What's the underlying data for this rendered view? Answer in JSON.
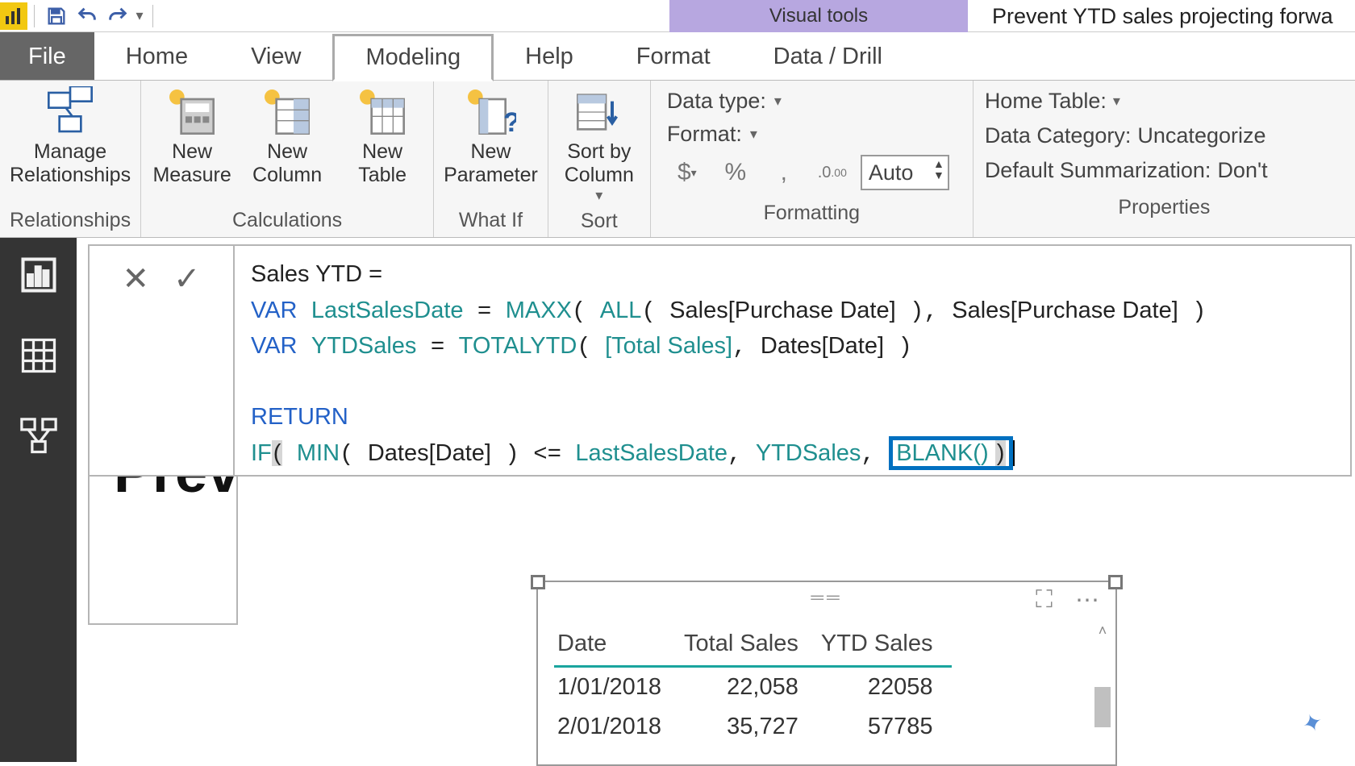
{
  "qat": {
    "save_label": "Save",
    "undo_label": "Undo",
    "redo_label": "Redo"
  },
  "titlebar": {
    "context_tab": "Visual tools",
    "doc_title": "Prevent YTD sales projecting forwa"
  },
  "tabs": {
    "file": "File",
    "home": "Home",
    "view": "View",
    "modeling": "Modeling",
    "help": "Help",
    "format": "Format",
    "data_drill": "Data / Drill"
  },
  "ribbon": {
    "relationships": {
      "manage": "Manage\nRelationships",
      "group": "Relationships"
    },
    "calculations": {
      "new_measure": "New\nMeasure",
      "new_column": "New\nColumn",
      "new_table": "New\nTable",
      "group": "Calculations"
    },
    "whatif": {
      "new_parameter": "New\nParameter",
      "group": "What If"
    },
    "sort": {
      "sort_by_column": "Sort by\nColumn",
      "group": "Sort"
    },
    "formatting": {
      "data_type": "Data type:",
      "format": "Format:",
      "auto": "Auto",
      "group": "Formatting",
      "currency": "$",
      "percent": "%",
      "comma": ",",
      "decimals": ".00"
    },
    "properties": {
      "home_table": "Home Table:",
      "data_category": "Data Category:",
      "data_category_value": "Uncategorize",
      "default_summ": "Default Summarization:",
      "default_summ_value": "Don't",
      "group": "Properties"
    }
  },
  "formula": {
    "line1_a": "Sales YTD = ",
    "var_kw": "VAR",
    "lastsalesdate": "LastSalesDate",
    "maxx": "MAXX",
    "all": "ALL",
    "sales_purchase": "Sales[Purchase Date]",
    "ytdsales": "YTDSales",
    "totalytd": "TOTALYTD",
    "total_sales_m": "[Total Sales]",
    "dates_date": "Dates[Date]",
    "return_kw": "RETURN",
    "if": "IF",
    "min": "MIN",
    "blank": "BLANK()"
  },
  "page": {
    "title": "Prev"
  },
  "table": {
    "headers": [
      "Date",
      "Total Sales",
      "YTD Sales"
    ],
    "rows": [
      {
        "date": "1/01/2018",
        "total": "22,058",
        "ytd": "22058"
      },
      {
        "date": "2/01/2018",
        "total": "35,727",
        "ytd": "57785"
      }
    ]
  }
}
